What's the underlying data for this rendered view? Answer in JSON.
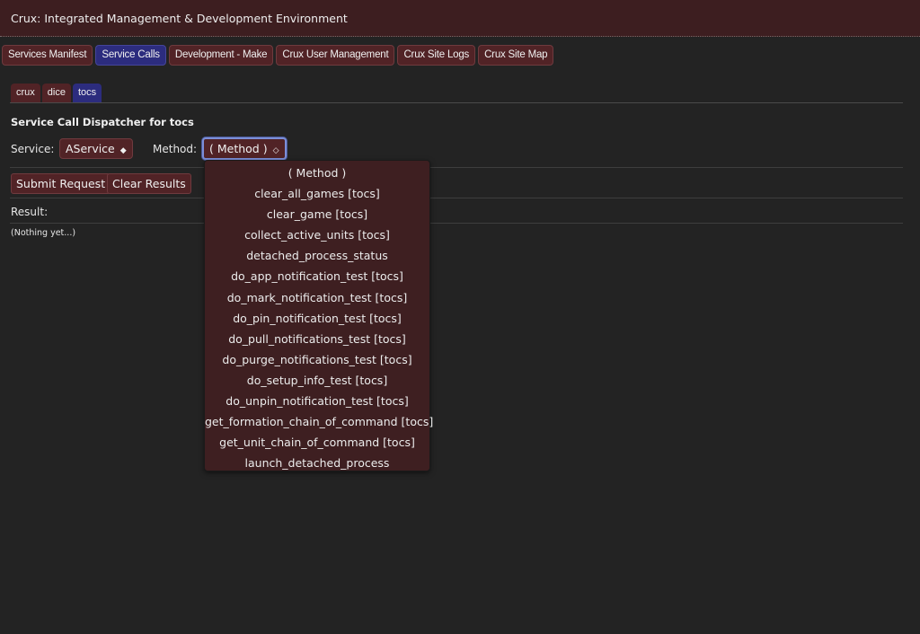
{
  "app": {
    "title": "Crux: Integrated Management & Development Environment"
  },
  "tabs": [
    {
      "label": "Services Manifest",
      "active": false
    },
    {
      "label": "Service Calls",
      "active": true
    },
    {
      "label": "Development - Make",
      "active": false
    },
    {
      "label": "Crux User Management",
      "active": false
    },
    {
      "label": "Crux Site Logs",
      "active": false
    },
    {
      "label": "Crux Site Map",
      "active": false
    }
  ],
  "subtabs": [
    {
      "label": "crux",
      "active": false
    },
    {
      "label": "dice",
      "active": false
    },
    {
      "label": "tocs",
      "active": true
    }
  ],
  "dispatcher": {
    "heading": "Service Call Dispatcher for tocs",
    "service_label": "Service:",
    "service_value": "AService",
    "service_arrow": "◆",
    "method_label": "Method:",
    "method_value": "( Method )",
    "method_arrow": "◇",
    "submit_label": "Submit Request",
    "clear_label": "Clear Results",
    "result_label": "Result:",
    "result_value": "(Nothing yet...)"
  },
  "method_options": [
    "( Method )",
    "clear_all_games [tocs]",
    "clear_game [tocs]",
    "collect_active_units [tocs]",
    "detached_process_status",
    "do_app_notification_test [tocs]",
    "do_mark_notification_test [tocs]",
    "do_pin_notification_test [tocs]",
    "do_pull_notifications_test [tocs]",
    "do_purge_notifications_test [tocs]",
    "do_setup_info_test [tocs]",
    "do_unpin_notification_test [tocs]",
    "get_formation_chain_of_command [tocs]",
    "get_unit_chain_of_command [tocs]",
    "launch_detached_process"
  ]
}
